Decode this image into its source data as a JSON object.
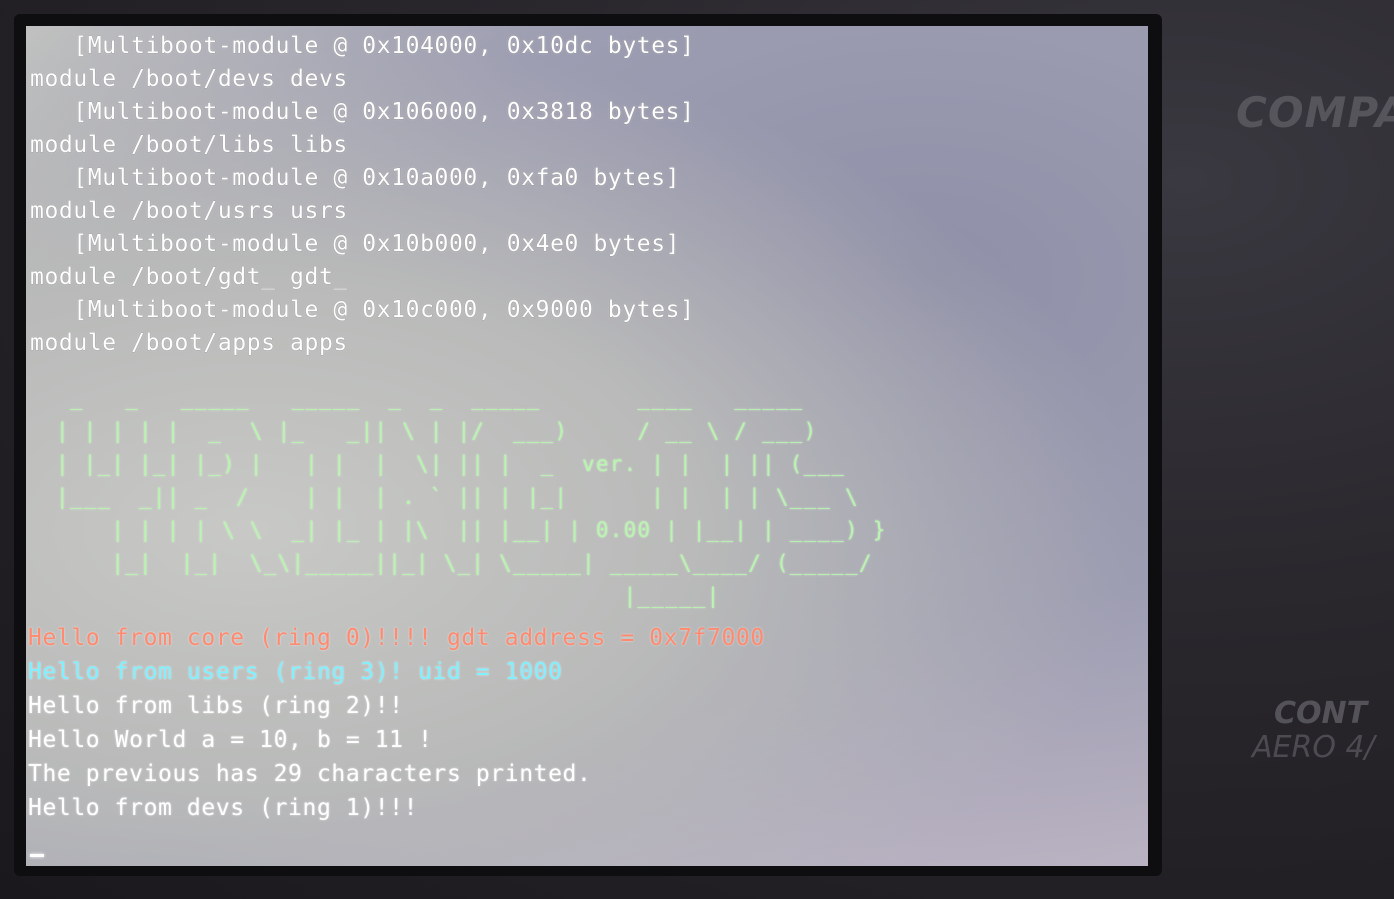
{
  "bezel": {
    "brand": "COMPA",
    "model_line1": "CONT",
    "model_line2": "AERO 4/"
  },
  "boot_log": [
    "   [Multiboot-module @ 0x104000, 0x10dc bytes]",
    "module /boot/devs devs",
    "   [Multiboot-module @ 0x106000, 0x3818 bytes]",
    "module /boot/libs libs",
    "   [Multiboot-module @ 0x10a000, 0xfa0 bytes]",
    "module /boot/usrs usrs",
    "   [Multiboot-module @ 0x10b000, 0x4e0 bytes]",
    "module /boot/gdt_ gdt_",
    "   [Multiboot-module @ 0x10c000, 0x9000 bytes]",
    "module /boot/apps apps"
  ],
  "ascii_logo": [
    " _   _   _____   _____  _  _  _____       ____   _____ ",
    "| | | | |  _  \\ |_   _|| \\ | |/  ___)     / __ \\ / ___) ",
    "| |_| |_| |_) |   | |  |  \\| || |  _  ver. | |  | || (___ ",
    "|___  _|| _  /    | |  | . ` || | |_|      | |  | | \\___ \\",
    "    | | | | \\ \\  _| |_ | |\\  || |__| | 0.00 | |__| | ____) }",
    "    |_|  |_|  \\_\\|_____||_| \\_| \\_____| _____\\____/ (_____/",
    "                                         |_____|"
  ],
  "output": [
    {
      "text": "Hello from core (ring 0)!!!! gdt address = 0x7f7000",
      "color": "#ff8a70"
    },
    {
      "text": "Hello from users (ring 3)! uid = 1000",
      "color": "#7ff0ff"
    },
    {
      "text": "Hello from libs (ring 2)!!",
      "color": "#ffffff"
    },
    {
      "text": "Hello World a = 10, b = 11 !",
      "color": "#ffffff"
    },
    {
      "text": "The previous has 29 characters printed.",
      "color": "#ffffff"
    },
    {
      "text": "Hello from devs (ring 1)!!!",
      "color": "#ffffff"
    }
  ]
}
